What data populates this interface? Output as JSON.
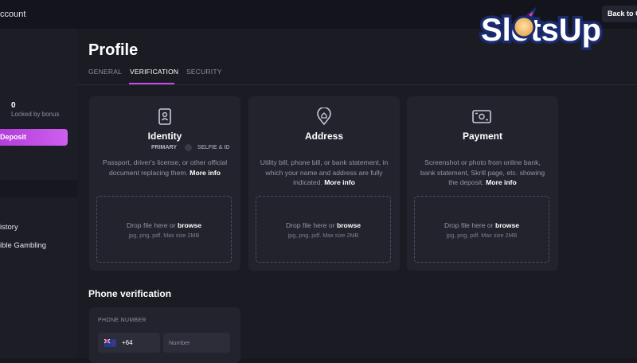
{
  "sidebar": {
    "account_title": "ccount",
    "locked_value": "0",
    "locked_label": "Locked by bonus",
    "deposit_label": "Deposit",
    "links": [
      "istory",
      "ible Gambling"
    ]
  },
  "header": {
    "back_label": "Back to Ca",
    "brand": "SlotsUp"
  },
  "profile": {
    "title": "Profile",
    "tabs": [
      "GENERAL",
      "VERIFICATION",
      "SECURITY"
    ],
    "active_tab": "VERIFICATION"
  },
  "cards": [
    {
      "icon": "id-card-icon",
      "title": "Identity",
      "primary": "PRIMARY",
      "secondary": "SELFIE & ID",
      "desc": "Passport, driver's license, or other official document replacing them.",
      "more": "More info",
      "drop_text": "Drop file here or",
      "drop_link": "browse",
      "drop_hint": "jpg, png, pdf. Max size 2MB"
    },
    {
      "icon": "location-home-icon",
      "title": "Address",
      "desc": "Utility bill, phone bill, or bank statement, in which your name and address are fully indicated.",
      "more": "More info",
      "drop_text": "Drop file here or",
      "drop_link": "browse",
      "drop_hint": "jpg, png, pdf. Max size 2MB"
    },
    {
      "icon": "payment-card-icon",
      "title": "Payment",
      "desc": "Screenshot or photo from online bank, bank statement, Skrill page, etc. showing the deposit.",
      "more": "More info",
      "drop_text": "Drop file here or",
      "drop_link": "browse",
      "drop_hint": "jpg, png, pdf. Max size 2MB"
    }
  ],
  "phone": {
    "title": "Phone verification",
    "label": "PHONE NUMBER",
    "country_code": "+64",
    "flag": "new-zealand-flag-icon",
    "number_placeholder": "Number"
  },
  "colors": {
    "accent": "#c64be9",
    "background": "#16171f",
    "card": "#22232d"
  }
}
